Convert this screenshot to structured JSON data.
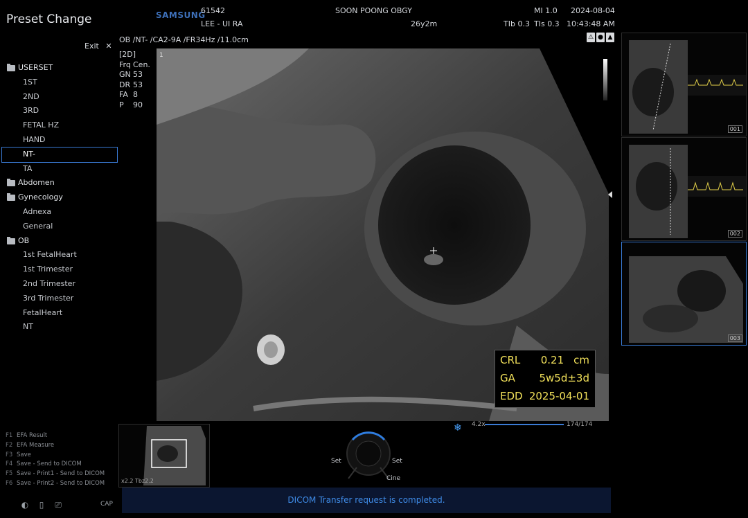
{
  "sidebar": {
    "title": "Preset Change",
    "exit_label": "Exit",
    "close_icon": "close-icon",
    "tree": [
      {
        "label": "USERSET",
        "type": "folder"
      },
      {
        "label": "1ST",
        "type": "child"
      },
      {
        "label": "2ND",
        "type": "child"
      },
      {
        "label": "3RD",
        "type": "child"
      },
      {
        "label": "FETAL HZ",
        "type": "child"
      },
      {
        "label": "HAND",
        "type": "child"
      },
      {
        "label": "NT-",
        "type": "child",
        "selected": true
      },
      {
        "label": "TA",
        "type": "child"
      },
      {
        "label": "Abdomen",
        "type": "folder"
      },
      {
        "label": "Gynecology",
        "type": "folder"
      },
      {
        "label": "Adnexa",
        "type": "child"
      },
      {
        "label": "General",
        "type": "child"
      },
      {
        "label": "OB",
        "type": "folder"
      },
      {
        "label": "1st FetalHeart",
        "type": "child"
      },
      {
        "label": "1st Trimester",
        "type": "child"
      },
      {
        "label": "2nd Trimester",
        "type": "child"
      },
      {
        "label": "3rd Trimester",
        "type": "child"
      },
      {
        "label": "FetalHeart",
        "type": "child"
      },
      {
        "label": "NT",
        "type": "child"
      }
    ],
    "shortcuts": [
      {
        "key": "F1",
        "label": "EFA Result"
      },
      {
        "key": "F2",
        "label": "EFA Measure"
      },
      {
        "key": "F3",
        "label": "Save"
      },
      {
        "key": "F4",
        "label": "Save - Send to DICOM"
      },
      {
        "key": "F5",
        "label": "Save - Print1 - Send to DICOM"
      },
      {
        "key": "F6",
        "label": "Save - Print2 - Send to DICOM"
      }
    ],
    "cap_label": "CAP"
  },
  "header": {
    "brand": "SAMSUNG",
    "patient_id": "61542",
    "patient_name": "LEE - UI RA",
    "institution": "SOON POONG OBGY",
    "age": "26y2m",
    "mi": "MI 1.0",
    "tib": "TIb 0.3",
    "tis": "TIs 0.3",
    "date": "2024-08-04",
    "time": "10:43:48 AM"
  },
  "image": {
    "probe_line": "OB /NT- /CA2-9A /FR34Hz /11.0cm",
    "mode": "[2D]",
    "params": [
      {
        "k": "Frq",
        "v": "Cen."
      },
      {
        "k": "GN",
        "v": "53"
      },
      {
        "k": "DR",
        "v": "53"
      },
      {
        "k": "FA",
        "v": "8"
      },
      {
        "k": "P",
        "v": "90"
      }
    ]
  },
  "measurements": [
    {
      "key": "CRL",
      "value": "0.21",
      "unit": "cm"
    },
    {
      "key": "GA",
      "value": "5w5d±3d",
      "unit": ""
    },
    {
      "key": "EDD",
      "value": "2025-04-01",
      "unit": ""
    }
  ],
  "thumbnails": [
    {
      "label": "001"
    },
    {
      "label": "002"
    },
    {
      "label": "003"
    }
  ],
  "preview": {
    "label": "x2.2 Tbz2.2"
  },
  "zoom": {
    "left": "4.2x",
    "right": "174/174"
  },
  "dial": {
    "left": "Set",
    "right": "Set",
    "bottom": "Cine"
  },
  "status_message": "DICOM Transfer request is completed."
}
